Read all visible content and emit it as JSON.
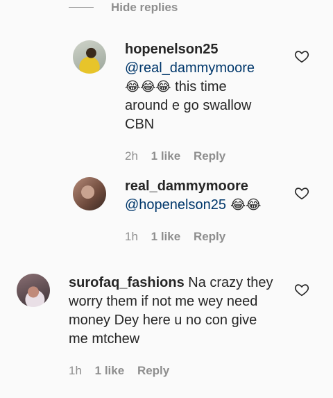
{
  "hide_replies": "Hide replies",
  "comments": [
    {
      "username": "hopenelson25",
      "mention": "@real_dammymoore",
      "emojis": "😂😂😂",
      "text_line1": " this time",
      "text_line2": "around e go swallow",
      "text_line3": "CBN",
      "time": "2h",
      "likes": "1 like",
      "reply": "Reply"
    },
    {
      "username": "real_dammymoore",
      "mention": "@hopenelson25",
      "emojis": " 😂😂",
      "time": "1h",
      "likes": "1 like",
      "reply": "Reply"
    },
    {
      "username": "surofaq_fashions",
      "text_line1": " Na crazy they",
      "text_line2": "worry them if not me wey need",
      "text_line3": "money Dey here u no con give",
      "text_line4": "me mtchew",
      "time": "1h",
      "likes": "1 like",
      "reply": "Reply"
    }
  ],
  "icons": {
    "like": "heart-outline-icon"
  },
  "colors": {
    "link": "#00376b",
    "muted": "#8e8e8e",
    "text": "#262626"
  }
}
